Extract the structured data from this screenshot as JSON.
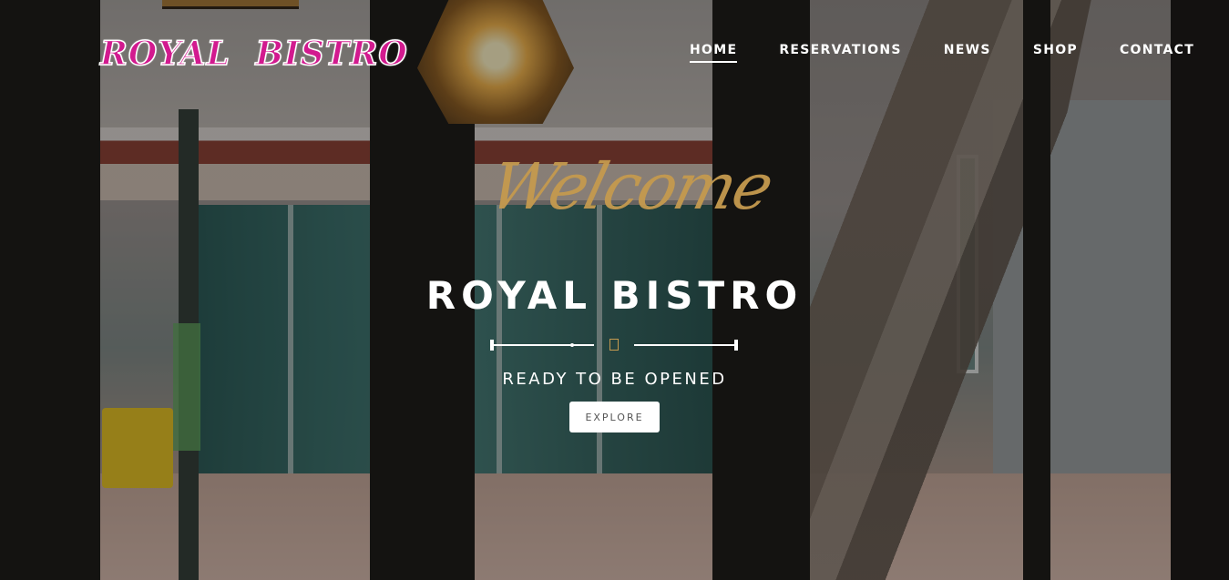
{
  "brand": {
    "logo_text": "ROYAL BISTRO"
  },
  "nav": {
    "items": [
      {
        "label": "HOME",
        "active": true
      },
      {
        "label": "RESERVATIONS",
        "active": false
      },
      {
        "label": "NEWS",
        "active": false
      },
      {
        "label": "SHOP",
        "active": false
      },
      {
        "label": "CONTACT",
        "active": false
      }
    ]
  },
  "hero": {
    "script_text": "Welcome",
    "title": "ROYAL BISTRO",
    "subtitle": "READY TO BE OPENED",
    "cta_label": "EXPLORE",
    "divider_icon": "square-outline-icon"
  },
  "colors": {
    "logo": "#d21a8f",
    "script_accent": "#c59a4f",
    "text": "#ffffff",
    "button_bg": "#ffffff"
  }
}
